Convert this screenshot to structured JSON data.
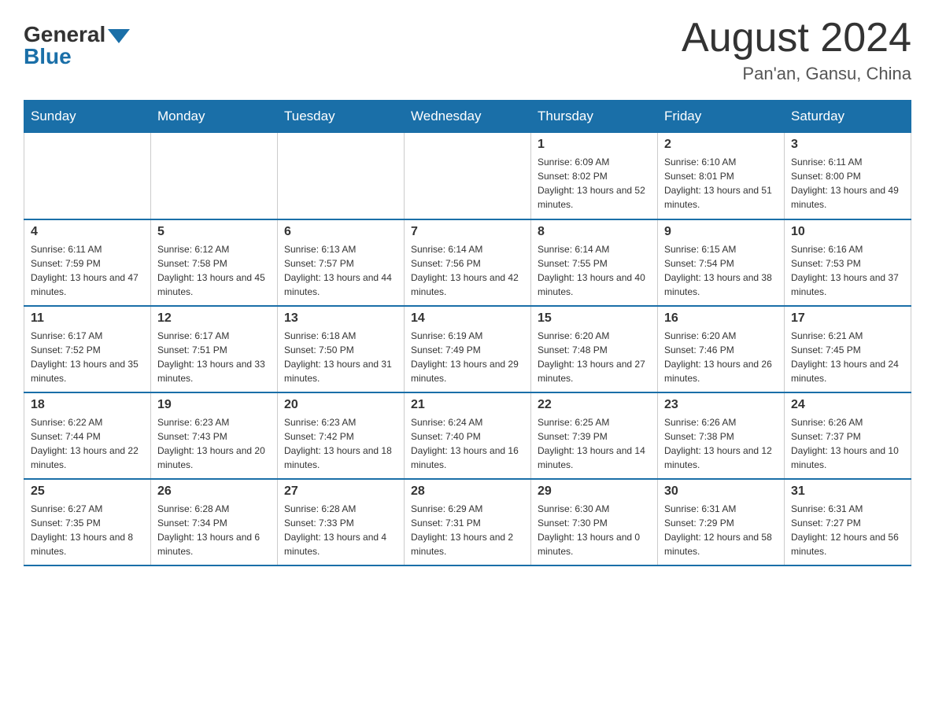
{
  "logo": {
    "general": "General",
    "blue": "Blue"
  },
  "title": {
    "month": "August 2024",
    "location": "Pan'an, Gansu, China"
  },
  "weekdays": [
    "Sunday",
    "Monday",
    "Tuesday",
    "Wednesday",
    "Thursday",
    "Friday",
    "Saturday"
  ],
  "weeks": [
    [
      {
        "day": "",
        "info": ""
      },
      {
        "day": "",
        "info": ""
      },
      {
        "day": "",
        "info": ""
      },
      {
        "day": "",
        "info": ""
      },
      {
        "day": "1",
        "info": "Sunrise: 6:09 AM\nSunset: 8:02 PM\nDaylight: 13 hours and 52 minutes."
      },
      {
        "day": "2",
        "info": "Sunrise: 6:10 AM\nSunset: 8:01 PM\nDaylight: 13 hours and 51 minutes."
      },
      {
        "day": "3",
        "info": "Sunrise: 6:11 AM\nSunset: 8:00 PM\nDaylight: 13 hours and 49 minutes."
      }
    ],
    [
      {
        "day": "4",
        "info": "Sunrise: 6:11 AM\nSunset: 7:59 PM\nDaylight: 13 hours and 47 minutes."
      },
      {
        "day": "5",
        "info": "Sunrise: 6:12 AM\nSunset: 7:58 PM\nDaylight: 13 hours and 45 minutes."
      },
      {
        "day": "6",
        "info": "Sunrise: 6:13 AM\nSunset: 7:57 PM\nDaylight: 13 hours and 44 minutes."
      },
      {
        "day": "7",
        "info": "Sunrise: 6:14 AM\nSunset: 7:56 PM\nDaylight: 13 hours and 42 minutes."
      },
      {
        "day": "8",
        "info": "Sunrise: 6:14 AM\nSunset: 7:55 PM\nDaylight: 13 hours and 40 minutes."
      },
      {
        "day": "9",
        "info": "Sunrise: 6:15 AM\nSunset: 7:54 PM\nDaylight: 13 hours and 38 minutes."
      },
      {
        "day": "10",
        "info": "Sunrise: 6:16 AM\nSunset: 7:53 PM\nDaylight: 13 hours and 37 minutes."
      }
    ],
    [
      {
        "day": "11",
        "info": "Sunrise: 6:17 AM\nSunset: 7:52 PM\nDaylight: 13 hours and 35 minutes."
      },
      {
        "day": "12",
        "info": "Sunrise: 6:17 AM\nSunset: 7:51 PM\nDaylight: 13 hours and 33 minutes."
      },
      {
        "day": "13",
        "info": "Sunrise: 6:18 AM\nSunset: 7:50 PM\nDaylight: 13 hours and 31 minutes."
      },
      {
        "day": "14",
        "info": "Sunrise: 6:19 AM\nSunset: 7:49 PM\nDaylight: 13 hours and 29 minutes."
      },
      {
        "day": "15",
        "info": "Sunrise: 6:20 AM\nSunset: 7:48 PM\nDaylight: 13 hours and 27 minutes."
      },
      {
        "day": "16",
        "info": "Sunrise: 6:20 AM\nSunset: 7:46 PM\nDaylight: 13 hours and 26 minutes."
      },
      {
        "day": "17",
        "info": "Sunrise: 6:21 AM\nSunset: 7:45 PM\nDaylight: 13 hours and 24 minutes."
      }
    ],
    [
      {
        "day": "18",
        "info": "Sunrise: 6:22 AM\nSunset: 7:44 PM\nDaylight: 13 hours and 22 minutes."
      },
      {
        "day": "19",
        "info": "Sunrise: 6:23 AM\nSunset: 7:43 PM\nDaylight: 13 hours and 20 minutes."
      },
      {
        "day": "20",
        "info": "Sunrise: 6:23 AM\nSunset: 7:42 PM\nDaylight: 13 hours and 18 minutes."
      },
      {
        "day": "21",
        "info": "Sunrise: 6:24 AM\nSunset: 7:40 PM\nDaylight: 13 hours and 16 minutes."
      },
      {
        "day": "22",
        "info": "Sunrise: 6:25 AM\nSunset: 7:39 PM\nDaylight: 13 hours and 14 minutes."
      },
      {
        "day": "23",
        "info": "Sunrise: 6:26 AM\nSunset: 7:38 PM\nDaylight: 13 hours and 12 minutes."
      },
      {
        "day": "24",
        "info": "Sunrise: 6:26 AM\nSunset: 7:37 PM\nDaylight: 13 hours and 10 minutes."
      }
    ],
    [
      {
        "day": "25",
        "info": "Sunrise: 6:27 AM\nSunset: 7:35 PM\nDaylight: 13 hours and 8 minutes."
      },
      {
        "day": "26",
        "info": "Sunrise: 6:28 AM\nSunset: 7:34 PM\nDaylight: 13 hours and 6 minutes."
      },
      {
        "day": "27",
        "info": "Sunrise: 6:28 AM\nSunset: 7:33 PM\nDaylight: 13 hours and 4 minutes."
      },
      {
        "day": "28",
        "info": "Sunrise: 6:29 AM\nSunset: 7:31 PM\nDaylight: 13 hours and 2 minutes."
      },
      {
        "day": "29",
        "info": "Sunrise: 6:30 AM\nSunset: 7:30 PM\nDaylight: 13 hours and 0 minutes."
      },
      {
        "day": "30",
        "info": "Sunrise: 6:31 AM\nSunset: 7:29 PM\nDaylight: 12 hours and 58 minutes."
      },
      {
        "day": "31",
        "info": "Sunrise: 6:31 AM\nSunset: 7:27 PM\nDaylight: 12 hours and 56 minutes."
      }
    ]
  ]
}
